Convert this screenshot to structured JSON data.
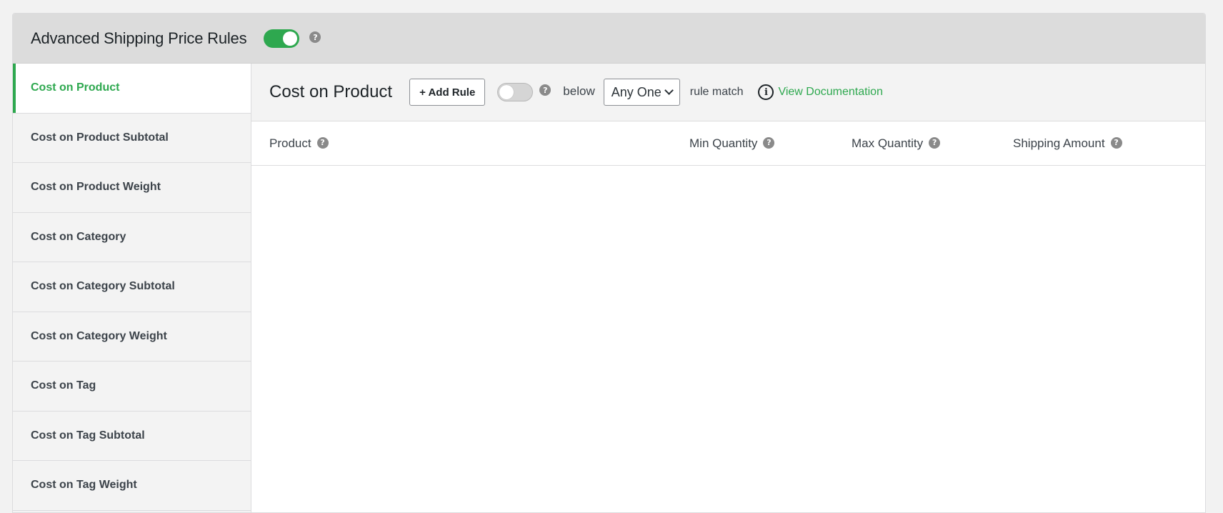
{
  "header": {
    "title": "Advanced Shipping Price Rules",
    "toggle_on": true,
    "help_icon": "?"
  },
  "sidebar": {
    "items": [
      {
        "label": "Cost on Product",
        "active": true
      },
      {
        "label": "Cost on Product Subtotal"
      },
      {
        "label": "Cost on Product Weight"
      },
      {
        "label": "Cost on Category"
      },
      {
        "label": "Cost on Category Subtotal"
      },
      {
        "label": "Cost on Category Weight"
      },
      {
        "label": "Cost on Tag"
      },
      {
        "label": "Cost on Tag Subtotal"
      },
      {
        "label": "Cost on Tag Weight"
      }
    ]
  },
  "main": {
    "section_title": "Cost on Product",
    "add_rule_label": "+ Add Rule",
    "toggle_on": false,
    "help_icon": "?",
    "below_text": "below",
    "select_value": "Any One",
    "rule_match_text": "rule match",
    "doc_icon": "i",
    "doc_link_label": "View Documentation",
    "columns": [
      {
        "label": "Product",
        "help": "?"
      },
      {
        "label": "Min Quantity",
        "help": "?"
      },
      {
        "label": "Max Quantity",
        "help": "?"
      },
      {
        "label": "Shipping Amount",
        "help": "?"
      }
    ]
  },
  "colors": {
    "accent": "#2ea84f",
    "header_bg": "#dcdcdc",
    "sidebar_bg": "#f3f3f3"
  }
}
